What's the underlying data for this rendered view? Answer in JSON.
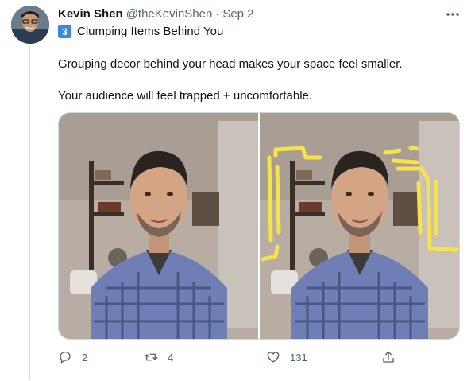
{
  "tweet": {
    "author_name": "Kevin Shen",
    "author_handle": "@theKevinShen",
    "separator": "·",
    "date": "Sep 2",
    "keycap_number": "3",
    "subtitle": "Clumping Items Behind You",
    "paragraph_1": "Grouping decor behind your head makes your space feel smaller.",
    "paragraph_2": "Your audience will feel trapped + uncomfortable."
  },
  "actions": {
    "reply_count": "2",
    "retweet_count": "4",
    "like_count": "131"
  },
  "icons": {
    "more": "more-horizontal-icon",
    "reply": "reply-icon",
    "retweet": "retweet-icon",
    "like": "heart-icon",
    "share": "share-icon"
  },
  "colors": {
    "text_primary": "#0f1419",
    "text_secondary": "#536471",
    "keycap_blue": "#3a88d9",
    "highlight_yellow": "#f7e24a",
    "thread_line": "#cfd9de"
  }
}
